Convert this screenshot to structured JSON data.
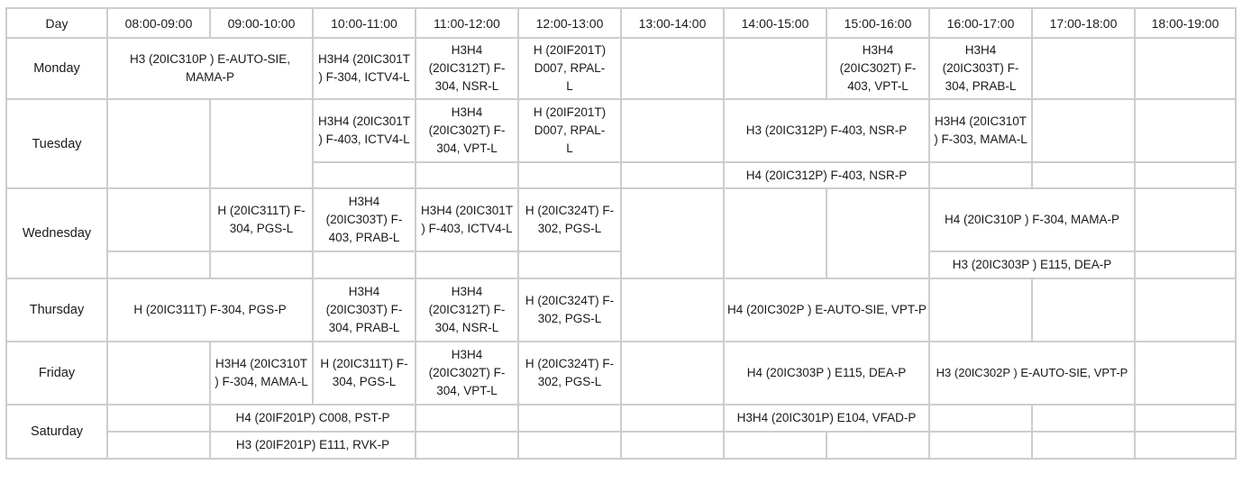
{
  "header": {
    "day": "Day",
    "slots": [
      "08:00-09:00",
      "09:00-10:00",
      "10:00-11:00",
      "11:00-12:00",
      "12:00-13:00",
      "13:00-14:00",
      "14:00-15:00",
      "15:00-16:00",
      "16:00-17:00",
      "17:00-18:00",
      "18:00-19:00"
    ]
  },
  "days": {
    "monday": "Monday",
    "tuesday": "Tuesday",
    "wednesday": "Wednesday",
    "thursday": "Thursday",
    "friday": "Friday",
    "saturday": "Saturday"
  },
  "entries": {
    "mon_08_10": "H3 (20IC310P ) E-AUTO-SIE, MAMA-P",
    "mon_10": "H3H4 (20IC301T ) F-304, ICTV4-L",
    "mon_11": "H3H4 (20IC312T) F-304, NSR-L",
    "mon_12": "H (20IF201T) D007, RPAL-L",
    "mon_15": "H3H4 (20IC302T) F-403, VPT-L",
    "mon_16": "H3H4 (20IC303T) F-304, PRAB-L",
    "tue_10": "H3H4 (20IC301T ) F-403, ICTV4-L",
    "tue_11": "H3H4 (20IC302T) F-304, VPT-L",
    "tue_12": "H (20IF201T) D007, RPAL-L",
    "tue_14_16_a": "H3 (20IC312P) F-403, NSR-P",
    "tue_16": "H3H4 (20IC310T ) F-303, MAMA-L",
    "tue_14_16_b": "H4 (20IC312P) F-403, NSR-P",
    "wed_09": "H (20IC311T) F-304, PGS-L",
    "wed_10": "H3H4 (20IC303T) F-403, PRAB-L",
    "wed_11": "H3H4 (20IC301T ) F-403, ICTV4-L",
    "wed_12": "H (20IC324T) F-302, PGS-L",
    "wed_16_18_a": "H4 (20IC310P ) F-304, MAMA-P",
    "wed_16_18_b": "H3 (20IC303P ) E115, DEA-P",
    "thu_08_10": "H (20IC311T) F-304, PGS-P",
    "thu_10": "H3H4 (20IC303T) F-304, PRAB-L",
    "thu_11": "H3H4 (20IC312T) F-304, NSR-L",
    "thu_12": "H (20IC324T) F-302, PGS-L",
    "thu_14_16": "H4 (20IC302P ) E-AUTO-SIE, VPT-P",
    "fri_09": "H3H4 (20IC310T ) F-304, MAMA-L",
    "fri_10": "H (20IC311T) F-304, PGS-L",
    "fri_11": "H3H4 (20IC302T) F-304, VPT-L",
    "fri_12": "H (20IC324T) F-302, PGS-L",
    "fri_14_16": "H4 (20IC303P ) E115, DEA-P",
    "fri_16_18": "H3 (20IC302P ) E-AUTO-SIE, VPT-P",
    "sat_09_11_a": "H4 (20IF201P) C008, PST-P",
    "sat_14_16": "H3H4 (20IC301P) E104, VFAD-P",
    "sat_09_11_b": "H3 (20IF201P) E111, RVK-P"
  }
}
